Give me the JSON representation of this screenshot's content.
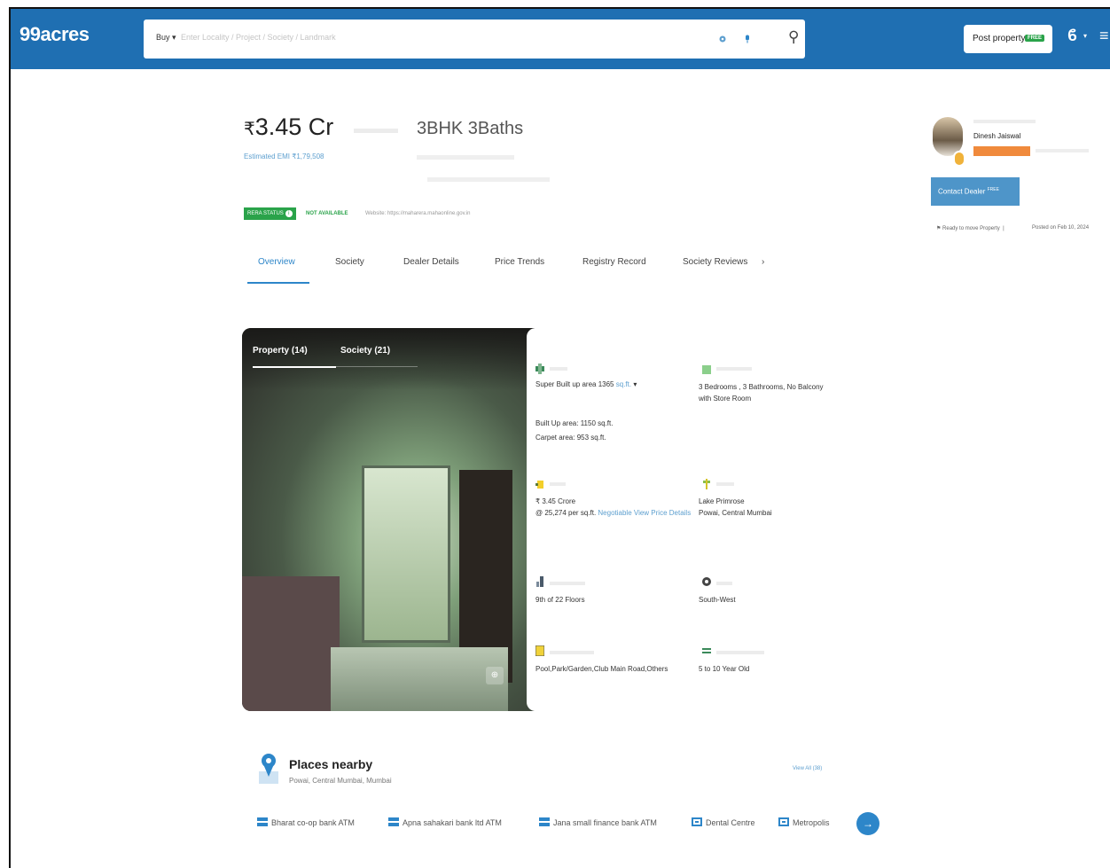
{
  "header": {
    "logo": "99acres",
    "search_mode": "Buy",
    "search_placeholder": "Enter Locality / Project / Society / Landmark",
    "search_icon": "magnifier",
    "post_property": "Post property",
    "post_badge": "FREE",
    "user_icon": "user-icon",
    "menu_icon": "menu-icon"
  },
  "listing": {
    "price": "3.45 Cr",
    "price_symbol": "₹",
    "emi": "Estimated EMI ₹1,79,508",
    "config": "3BHK 3Baths",
    "rera_status": "RERA STATUS",
    "rera_value": "NOT AVAILABLE",
    "rera_website": "Website: https://maharera.mahaonline.gov.in"
  },
  "tabs": [
    "Overview",
    "Society",
    "Dealer Details",
    "Price Trends",
    "Registry Record",
    "Society Reviews"
  ],
  "dealer": {
    "name": "Dinesh Jaiswal",
    "contact_label": "Contact Dealer",
    "contact_badge": "FREE",
    "ready": "Ready to move Property",
    "posted": "Posted on Feb 10, 2024"
  },
  "gallery": {
    "tabs": [
      "Property (14)",
      "Society (21)"
    ]
  },
  "details": {
    "area_line1": "Super Built up area 1365",
    "area_unit": "sq.ft.",
    "area_line2": "Built Up area: 1150 sq.ft.",
    "area_line3": "Carpet area: 953 sq.ft.",
    "config_line1": "3 Bedrooms , 3 Bathrooms, No Balcony",
    "config_line2": "with Store Room",
    "price_line1": "₹ 3.45 Crore",
    "price_line2": "@ 25,274 per sq.ft.",
    "price_negotiable": "Negotiable",
    "price_link": "View Price Details",
    "location_line1": "Lake Primrose",
    "location_line2": "Powai, Central Mumbai",
    "floor": "9th of 22 Floors",
    "facing": "South-West",
    "overlooking": "Pool,Park/Garden,Club Main Road,Others",
    "age": "5 to 10 Year Old"
  },
  "nearby": {
    "title": "Places nearby",
    "subtitle": "Powai, Central Mumbai, Mumbai",
    "view_all": "View All (38)",
    "chips": [
      "Bharat co-op bank ATM",
      "Apna sahakari bank ltd ATM",
      "Jana small finance bank ATM",
      "Dental Centre",
      "Metropolis"
    ]
  },
  "colors": {
    "header_bg": "#1f6fb2",
    "accent": "#2d86c9",
    "rera_green": "#2aa34a",
    "tag_orange": "#f08a3c"
  }
}
